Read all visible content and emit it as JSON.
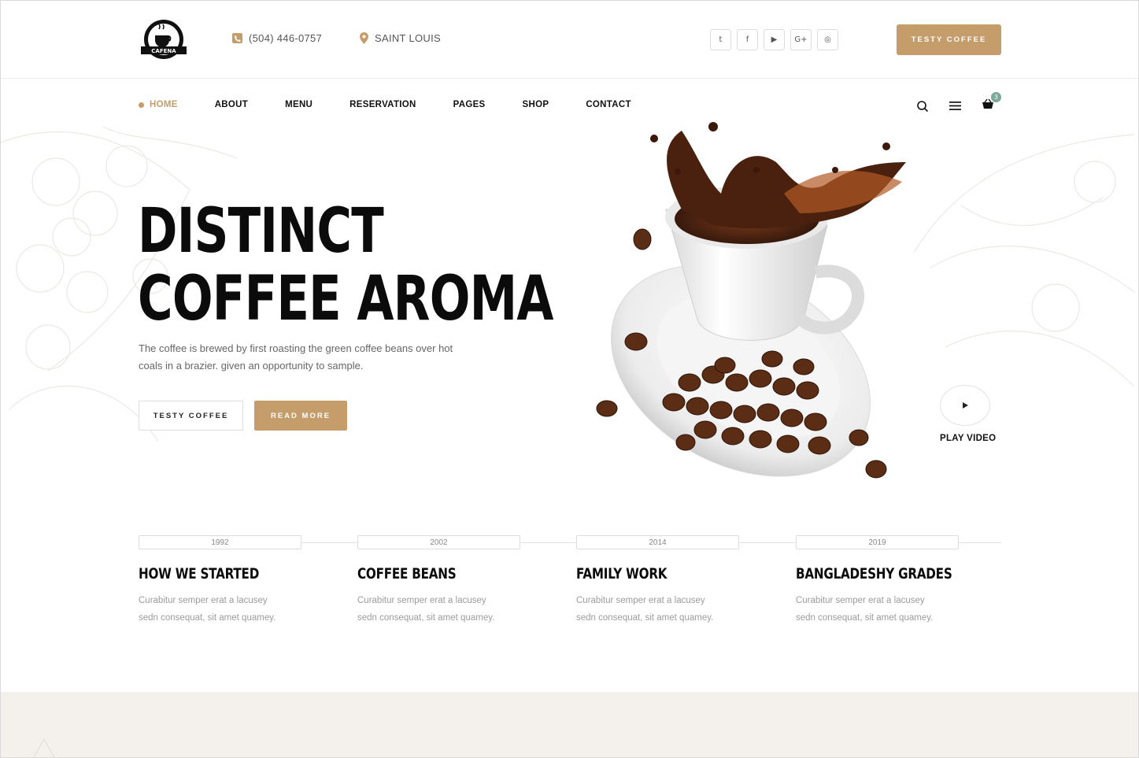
{
  "brand": {
    "logo_text": "CAFENA",
    "accent_color": "#c59d6b"
  },
  "topbar": {
    "phone": "(504) 446-0757",
    "location": "SAINT LOUIS",
    "social": [
      {
        "icon": "twitter-icon",
        "glyph": "t"
      },
      {
        "icon": "facebook-icon",
        "glyph": "f"
      },
      {
        "icon": "youtube-icon",
        "glyph": "▶"
      },
      {
        "icon": "google-plus-icon",
        "glyph": "G+"
      },
      {
        "icon": "instagram-icon",
        "glyph": "◎"
      }
    ],
    "cta_label": "TESTY COFFEE"
  },
  "nav": {
    "items": [
      "HOME",
      "ABOUT",
      "MENU",
      "RESERVATION",
      "PAGES",
      "SHOP",
      "CONTACT"
    ],
    "active_index": 0,
    "cart_count": "3"
  },
  "hero": {
    "title_line1": "DISTINCT",
    "title_line2": "COFFEE AROMA",
    "text": "The coffee is brewed by first roasting the green coffee beans over hot coals in a brazier. given an opportunity to sample.",
    "btn_outline": "TESTY COFFEE",
    "btn_fill": "READ MORE",
    "play_label": "PLAY VIDEO"
  },
  "timeline": [
    {
      "year": "1992",
      "title": "HOW WE STARTED",
      "text": "Curabitur semper erat a lacusey sedn consequat, sit amet quamey."
    },
    {
      "year": "2002",
      "title": "COFFEE BEANS",
      "text": "Curabitur semper erat a lacusey sedn consequat, sit amet quamey."
    },
    {
      "year": "2014",
      "title": "FAMILY WORK",
      "text": "Curabitur semper erat a lacusey sedn consequat, sit amet quamey."
    },
    {
      "year": "2019",
      "title": "BANGLADESHY GRADES",
      "text": "Curabitur semper erat a lacusey sedn consequat, sit amet quamey."
    }
  ]
}
